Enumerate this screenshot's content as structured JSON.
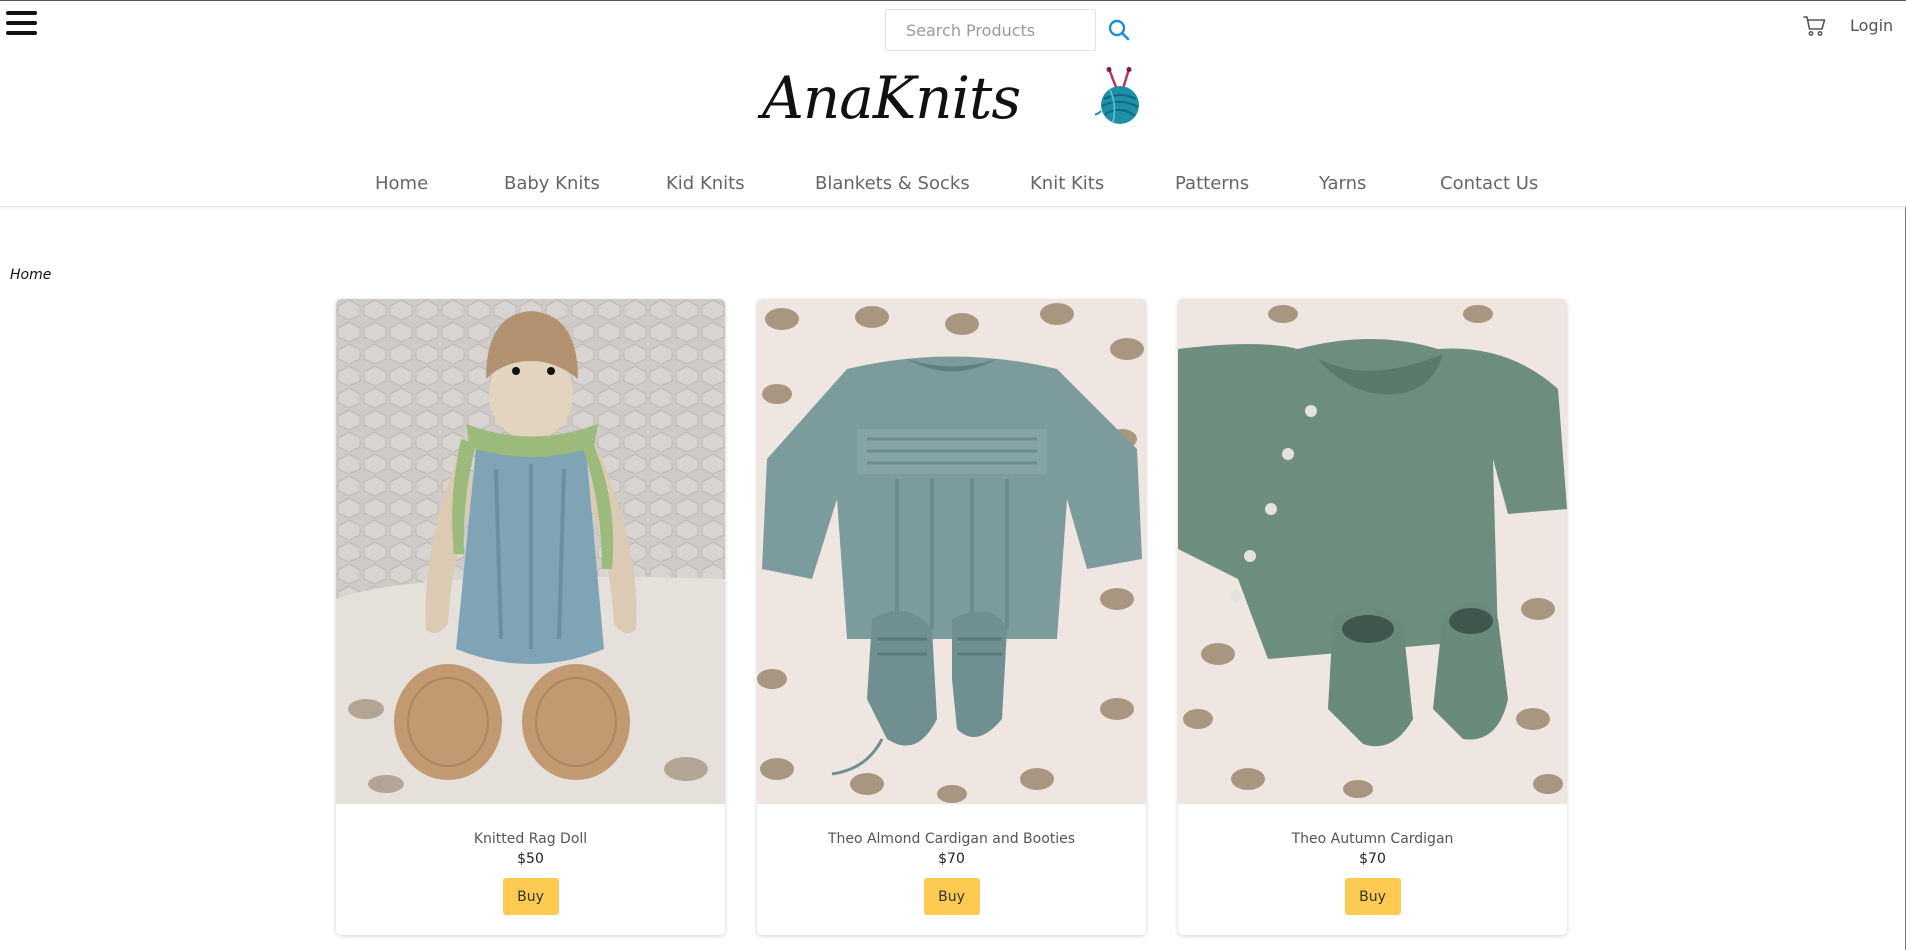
{
  "header": {
    "search_placeholder": "Search Products",
    "login_label": "Login",
    "logo_text": "AnaKnits"
  },
  "nav": {
    "items": [
      {
        "label": "Home"
      },
      {
        "label": "Baby Knits"
      },
      {
        "label": "Kid Knits"
      },
      {
        "label": "Blankets & Socks"
      },
      {
        "label": "Knit Kits"
      },
      {
        "label": "Patterns"
      },
      {
        "label": "Yarns"
      },
      {
        "label": "Contact Us"
      }
    ]
  },
  "breadcrumb": {
    "current": "Home"
  },
  "products": [
    {
      "name": "Knitted Rag Doll",
      "price": "$50",
      "button_label": "Buy"
    },
    {
      "name": "Theo Almond Cardigan and Booties",
      "price": "$70",
      "button_label": "Buy"
    },
    {
      "name": "Theo Autumn Cardigan",
      "price": "$70",
      "button_label": "Buy"
    }
  ],
  "colors": {
    "accent": "#fdcb52",
    "search_icon": "#1a8fd6",
    "nav_text": "#666666"
  },
  "icons": {
    "menu": "hamburger-menu-icon",
    "search": "search-icon",
    "cart": "cart-icon"
  }
}
